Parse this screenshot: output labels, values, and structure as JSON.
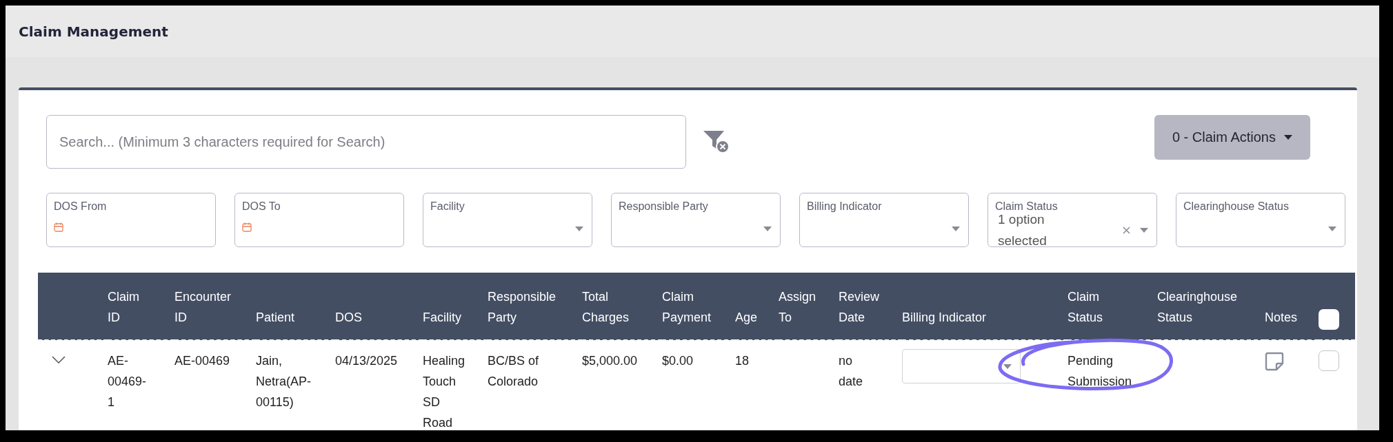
{
  "page": {
    "title": "Claim Management"
  },
  "search": {
    "placeholder": "Search... (Minimum 3 characters required for Search)"
  },
  "claim_actions": {
    "label": "0 - Claim Actions"
  },
  "filters": [
    {
      "kind": "date",
      "label": "DOS From"
    },
    {
      "kind": "date",
      "label": "DOS To"
    },
    {
      "kind": "select",
      "label": "Facility"
    },
    {
      "kind": "select",
      "label": "Responsible Party"
    },
    {
      "kind": "select",
      "label": "Billing Indicator"
    },
    {
      "kind": "select",
      "label": "Claim Status",
      "value": "1 option selected",
      "clearable": true
    },
    {
      "kind": "select",
      "label": "Clearinghouse Status"
    }
  ],
  "table": {
    "columns": [
      "Claim ID",
      "Encounter ID",
      "Patient",
      "DOS",
      "Facility",
      "Responsible Party",
      "Total Charges",
      "Claim Payment",
      "Age",
      "Assign To",
      "Review Date",
      "Billing Indicator",
      "Claim Status",
      "Clearinghouse Status",
      "Notes"
    ],
    "select_all": {
      "checked": false
    },
    "rows": [
      {
        "expanded": false,
        "selected": false,
        "cells": [
          {
            "kind": "text",
            "text": "AE-00469-1"
          },
          {
            "kind": "text",
            "text": "AE-00469"
          },
          {
            "kind": "text",
            "text": "Jain, Netra(AP-00115)"
          },
          {
            "kind": "text",
            "text": "04/13/2025"
          },
          {
            "kind": "text",
            "text": "Healing Touch SD Road"
          },
          {
            "kind": "text",
            "text": "BC/BS of Colorado"
          },
          {
            "kind": "text",
            "text": "$5,000.00"
          },
          {
            "kind": "text",
            "text": "$0.00"
          },
          {
            "kind": "text",
            "text": "18"
          },
          {
            "kind": "empty"
          },
          {
            "kind": "text",
            "text": "no date"
          },
          {
            "kind": "select"
          },
          {
            "kind": "text",
            "text": "Pending Submission",
            "circled": true
          },
          {
            "kind": "empty"
          },
          {
            "kind": "note"
          }
        ]
      }
    ]
  }
}
